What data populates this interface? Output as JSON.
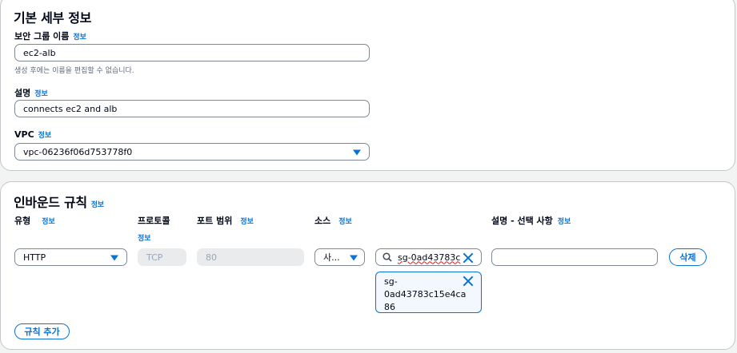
{
  "basic": {
    "title": "기본 세부 정보",
    "info": "정보",
    "group_name_label": "보안 그룹 이름",
    "group_name_value": "ec2-alb",
    "group_name_hint": "생성 후에는 이름을 편집할 수 없습니다.",
    "description_label": "설명",
    "description_value": "connects ec2 and alb",
    "vpc_label": "VPC",
    "vpc_value": "vpc-06236f06d753778f0"
  },
  "inbound": {
    "title": "인바운드 규칙",
    "info": "정보",
    "columns": {
      "type": "유형",
      "protocol": "프로토콜",
      "port_range": "포트 범위",
      "source": "소스",
      "description": "설명 - 선택 사항"
    },
    "rule": {
      "type": "HTTP",
      "protocol": "TCP",
      "port": "80",
      "source": "사...",
      "source_search": "sg-0ad43783c",
      "source_token": "sg-0ad43783c15e4ca86",
      "source_token_lines": [
        "sg-",
        "0ad43783c15e4ca",
        "86"
      ],
      "description": ""
    },
    "delete_button": "삭제",
    "add_rule_button": "규칙 추가"
  },
  "icons": {
    "search": "search-icon",
    "clear": "close-icon",
    "dropdown": "caret-down-icon"
  },
  "colors": {
    "accent": "#0972d3",
    "border": "#7d8998"
  }
}
